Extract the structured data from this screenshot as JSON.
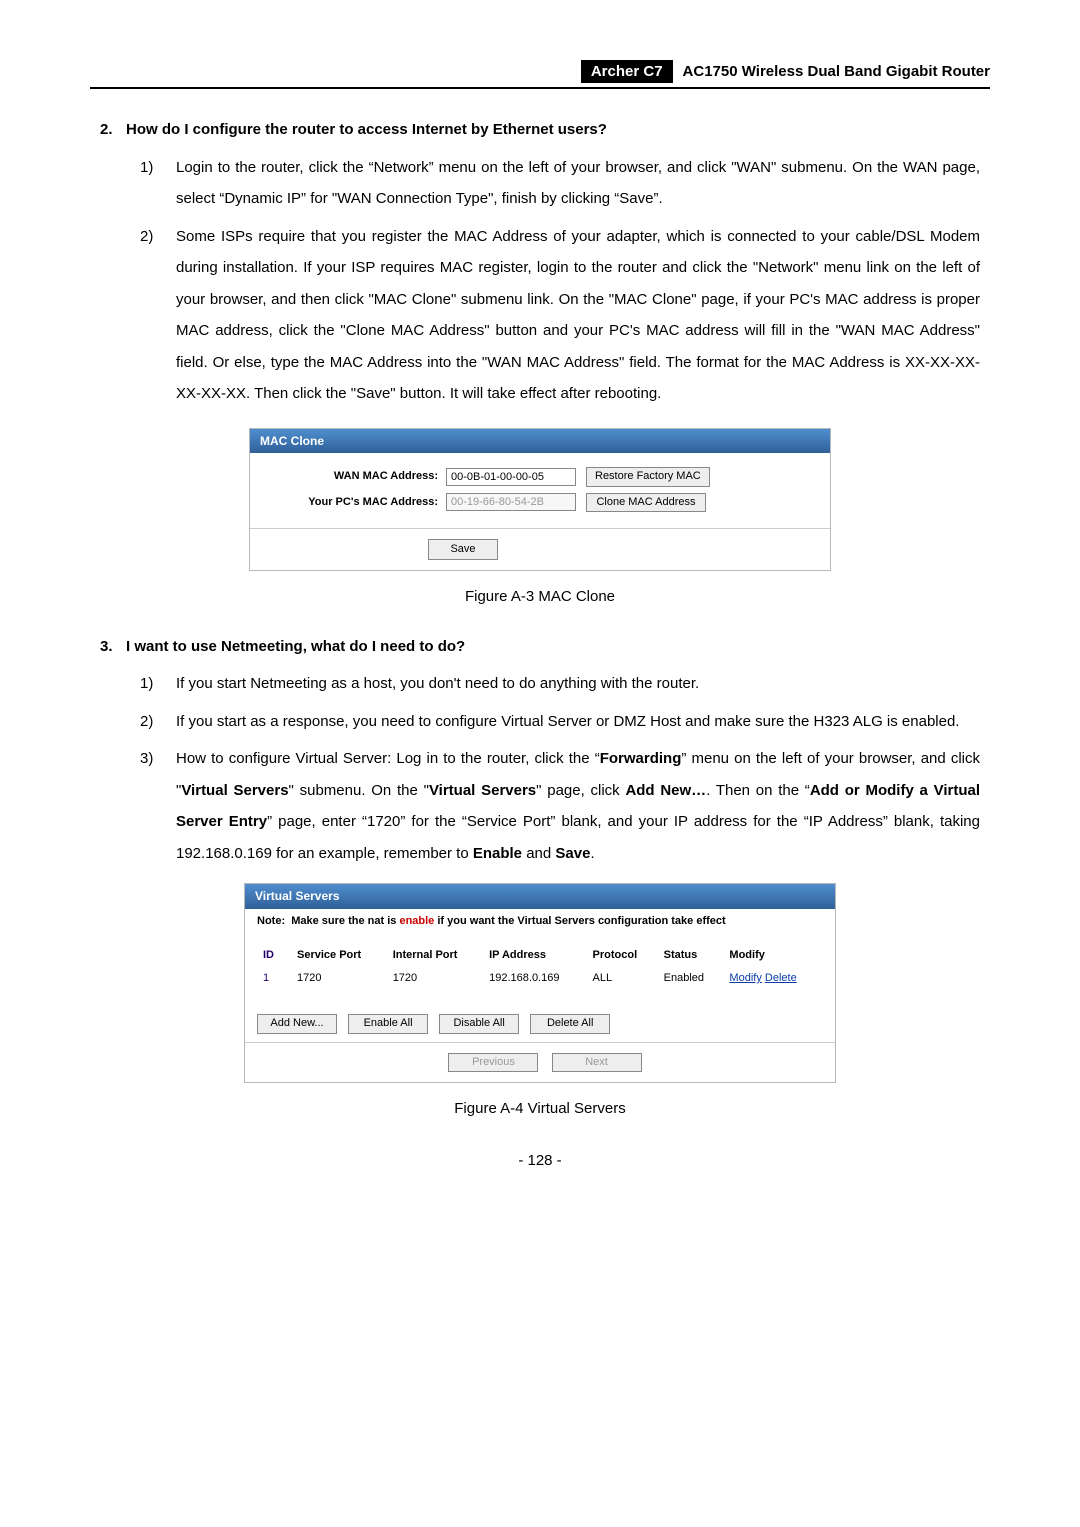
{
  "header": {
    "model": "Archer C7",
    "product": "AC1750 Wireless Dual Band Gigabit Router"
  },
  "q2": {
    "num": "2.",
    "title": "How do I configure the router to access Internet by Ethernet users?",
    "items": [
      {
        "num": "1)",
        "text": "Login to the router, click the “Network” menu on the left of your browser, and click \"WAN\" submenu. On the WAN page, select “Dynamic IP” for \"WAN Connection Type\", finish by clicking “Save”."
      },
      {
        "num": "2)",
        "text": "Some ISPs require that you register the MAC Address of your adapter, which is connected to your cable/DSL Modem during installation. If your ISP requires MAC register, login to the router and click the \"Network\" menu link on the left of your browser, and then click \"MAC Clone\" submenu link. On the \"MAC Clone\" page, if your PC's MAC address is proper MAC address, click the \"Clone MAC Address\" button and your PC's MAC address will fill in the \"WAN MAC Address\" field. Or else, type the MAC Address into the \"WAN MAC Address\" field. The format for the MAC Address is XX-XX-XX-XX-XX-XX. Then click the \"Save\" button. It will take effect after rebooting."
      }
    ]
  },
  "mac_clone": {
    "title": "MAC Clone",
    "wan_label": "WAN MAC Address:",
    "wan_value": "00-0B-01-00-00-05",
    "restore_btn": "Restore Factory MAC",
    "pc_label": "Your PC's MAC Address:",
    "pc_value": "00-19-66-80-54-2B",
    "clone_btn": "Clone MAC Address",
    "save_btn": "Save"
  },
  "fig_a3": "Figure A-3 MAC Clone",
  "q3": {
    "num": "3.",
    "title": "I want to use Netmeeting, what do I need to do?",
    "items": [
      {
        "num": "1)",
        "text": "If you start Netmeeting as a host, you don't need to do anything with the router."
      },
      {
        "num": "2)",
        "text": "If you start as a response, you need to configure Virtual Server or DMZ Host and make sure the H323 ALG is enabled."
      },
      {
        "num": "3)",
        "html": "How to configure Virtual Server: Log in to the router, click the “<b>Forwarding</b>” menu on the left of your browser, and click \"<b>Virtual Servers</b>\" submenu. On the \"<b>Virtual Servers</b>\" page, click <b>Add New…</b>. Then on the “<b>Add or Modify a Virtual Server Entry</b>” page, enter “1720” for the “Service Port” blank, and your IP address for the “IP Address” blank, taking 192.168.0.169 for an example, remember to <b>Enable</b> and <b>Save</b>."
      }
    ]
  },
  "vs": {
    "title": "Virtual Servers",
    "note_label": "Note:",
    "note_pre": "Make sure the nat is ",
    "note_enable": "enable",
    "note_post": " if you want the Virtual Servers configuration take effect",
    "headers": {
      "id": "ID",
      "sp": "Service Port",
      "ip_col": "Internal Port",
      "ip": "IP Address",
      "proto": "Protocol",
      "status": "Status",
      "modify": "Modify"
    },
    "row": {
      "id": "1",
      "sp": "1720",
      "ip_col": "1720",
      "ip": "192.168.0.169",
      "proto": "ALL",
      "status": "Enabled",
      "modify": "Modify",
      "delete": "Delete"
    },
    "btn_add": "Add New...",
    "btn_enable_all": "Enable All",
    "btn_disable_all": "Disable All",
    "btn_delete_all": "Delete All",
    "btn_prev": "Previous",
    "btn_next": "Next"
  },
  "fig_a4": "Figure A-4 Virtual Servers",
  "page_num": "- 128 -"
}
